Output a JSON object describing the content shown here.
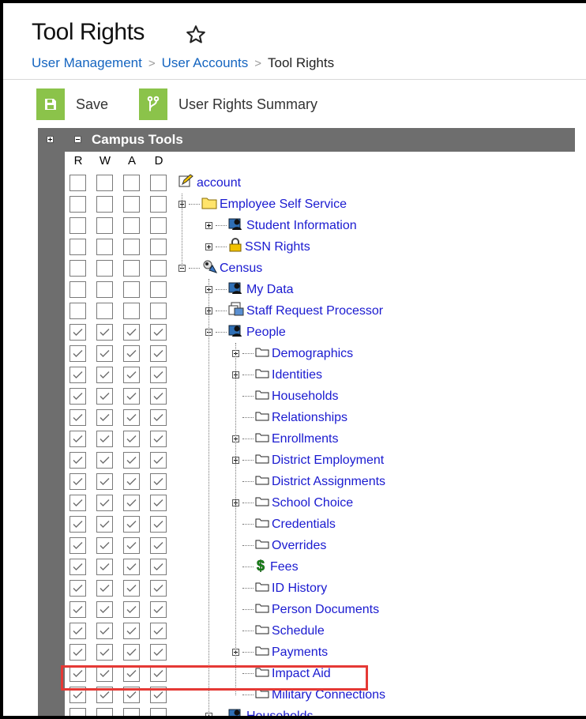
{
  "page": {
    "title": "Tool Rights",
    "breadcrumbs": [
      {
        "label": "User Management"
      },
      {
        "label": "User Accounts"
      },
      {
        "label": "Tool Rights"
      }
    ]
  },
  "toolbar": {
    "save_label": "Save",
    "summary_label": "User Rights Summary"
  },
  "tree": {
    "header": "Campus Tools",
    "columns": [
      "R",
      "W",
      "A",
      "D"
    ],
    "rows": [
      {
        "label": "account",
        "checked": false,
        "icon": "edit-icon",
        "expander": "none"
      },
      {
        "label": "Employee Self Service",
        "checked": false,
        "icon": "folder-icon",
        "expander": "plus"
      },
      {
        "label": "Student Information",
        "checked": false,
        "icon": "person-icon",
        "expander": "plus"
      },
      {
        "label": "SSN Rights",
        "checked": false,
        "icon": "lock-icon",
        "expander": "plus"
      },
      {
        "label": "Census",
        "checked": false,
        "icon": "census-icon",
        "expander": "minus"
      },
      {
        "label": "My Data",
        "checked": false,
        "icon": "person-icon",
        "expander": "plus"
      },
      {
        "label": "Staff Request Processor",
        "checked": false,
        "icon": "documents-icon",
        "expander": "plus"
      },
      {
        "label": "People",
        "checked": true,
        "icon": "person-icon",
        "expander": "minus"
      },
      {
        "label": "Demographics",
        "checked": true,
        "icon": "tab-icon",
        "expander": "plus"
      },
      {
        "label": "Identities",
        "checked": true,
        "icon": "tab-icon",
        "expander": "plus"
      },
      {
        "label": "Households",
        "checked": true,
        "icon": "tab-icon",
        "expander": "none"
      },
      {
        "label": "Relationships",
        "checked": true,
        "icon": "tab-icon",
        "expander": "none"
      },
      {
        "label": "Enrollments",
        "checked": true,
        "icon": "tab-icon",
        "expander": "plus"
      },
      {
        "label": "District Employment",
        "checked": true,
        "icon": "tab-icon",
        "expander": "plus"
      },
      {
        "label": "District Assignments",
        "checked": true,
        "icon": "tab-icon",
        "expander": "none"
      },
      {
        "label": "School Choice",
        "checked": true,
        "icon": "tab-icon",
        "expander": "plus"
      },
      {
        "label": "Credentials",
        "checked": true,
        "icon": "tab-icon",
        "expander": "none"
      },
      {
        "label": "Overrides",
        "checked": true,
        "icon": "tab-icon",
        "expander": "none"
      },
      {
        "label": "Fees",
        "checked": true,
        "icon": "dollar-icon",
        "expander": "none"
      },
      {
        "label": "ID History",
        "checked": true,
        "icon": "tab-icon",
        "expander": "none"
      },
      {
        "label": "Person Documents",
        "checked": true,
        "icon": "tab-icon",
        "expander": "none"
      },
      {
        "label": "Schedule",
        "checked": true,
        "icon": "tab-icon",
        "expander": "none"
      },
      {
        "label": "Payments",
        "checked": true,
        "icon": "tab-icon",
        "expander": "plus"
      },
      {
        "label": "Impact Aid",
        "checked": true,
        "icon": "tab-icon",
        "expander": "none"
      },
      {
        "label": "Military Connections",
        "checked": true,
        "icon": "tab-icon",
        "expander": "none"
      },
      {
        "label": "Households",
        "checked": false,
        "icon": "person-icon",
        "expander": "plus"
      }
    ]
  },
  "colors": {
    "accent_green": "#8bc34a",
    "link_blue": "#1a1ad0",
    "breadcrumb_blue": "#1565c0",
    "header_gray": "#6e6e6e",
    "highlight_red": "#e53935"
  }
}
